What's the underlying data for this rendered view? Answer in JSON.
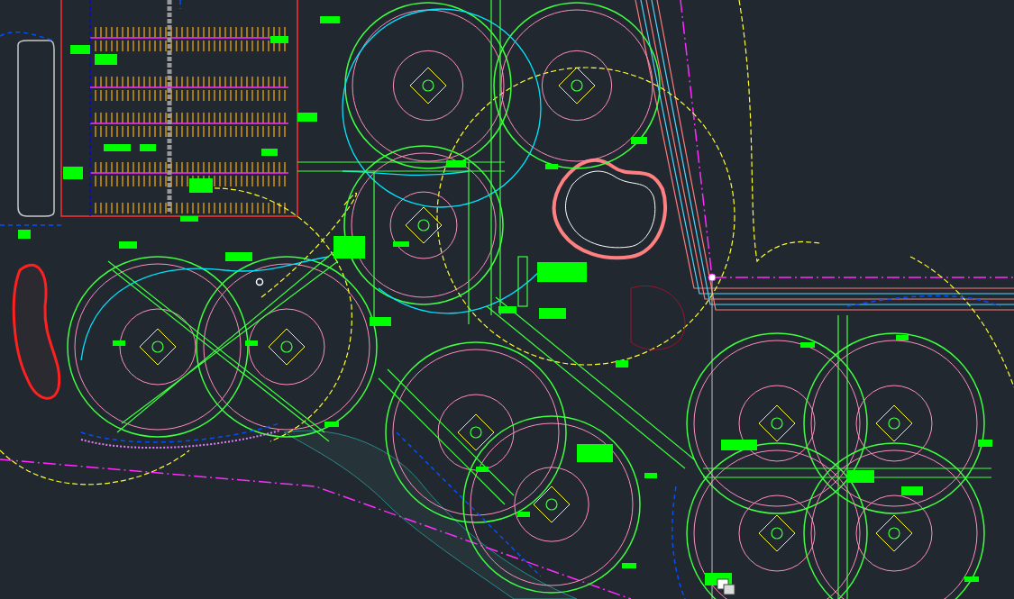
{
  "drawing": {
    "kind": "site-plan"
  }
}
